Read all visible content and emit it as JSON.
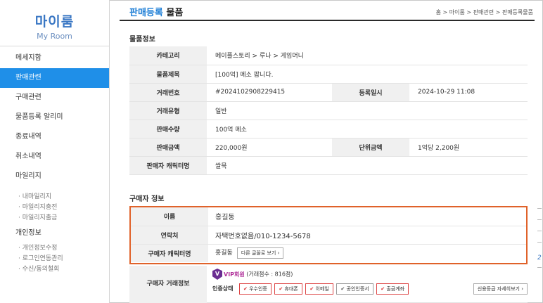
{
  "sidebar": {
    "brand_title": "마이룸",
    "brand_subtitle": "My Room",
    "items": [
      {
        "label": "메세지함"
      },
      {
        "label": "판매관련"
      },
      {
        "label": "구매관련"
      },
      {
        "label": "물품등록 알리미"
      },
      {
        "label": "종료내역"
      },
      {
        "label": "취소내역"
      },
      {
        "label": "마일리지"
      }
    ],
    "mileage_sub": [
      "· 내마일리지",
      "· 마일리지충전",
      "· 마일리지출금"
    ],
    "personal": "개인정보",
    "personal_sub": [
      "· 개인정보수정",
      "· 로그인연동관리",
      "· 수신/동의철회"
    ]
  },
  "header": {
    "title_accent": "판매등록",
    "title_rest": " 물품",
    "breadcrumb": "홈 > 마이룸 > 판매관련 > 판매등록물품"
  },
  "item_info": {
    "section_title": "물품정보",
    "category_label": "카테고리",
    "category_value": "메이플스토리 > 루나 > 게임머니",
    "subject_label": "물품제목",
    "subject_value": "[100억] 메소 팝니다.",
    "trade_no_label": "거래번호",
    "trade_no_value": "#2024102908229415",
    "reg_date_label": "등록일시",
    "reg_date_value": "2024-10-29 11:08",
    "trade_type_label": "거래유형",
    "trade_type_value": "일반",
    "qty_label": "판매수량",
    "qty_value": "100억 메소",
    "amount_label": "판매금액",
    "amount_value": "220,000원",
    "unit_label": "단위금액",
    "unit_value": "1억당 2,200원",
    "seller_char_label": "판매자 캐릭터명",
    "seller_char_value": "쌀묵"
  },
  "buyer_info": {
    "section_title": "구매자 정보",
    "name_label": "이름",
    "name_value": "홍길동",
    "contact_label": "연락처",
    "contact_value": "자택번호없음/010-1234-5678",
    "char_label": "구매자 캐릭터명",
    "char_value": "홍길동",
    "char_button": "다른 글꼴로 보기 ›"
  },
  "buyer_trade": {
    "label": "구매자 거래정보",
    "vip_badge": "V",
    "vip_level": "VIP회원",
    "vip_score": " (거래점수 : 816점)",
    "cert_label": "인증상태",
    "certs": [
      {
        "label": "우수인증",
        "mark": "✔"
      },
      {
        "label": "휴대폰",
        "mark": "✔"
      },
      {
        "label": "이메일",
        "mark": "✔"
      },
      {
        "label": "공인인증서",
        "mark": "✔"
      },
      {
        "label": "출금계좌",
        "mark": "✔"
      }
    ],
    "credit_button": "신용등급 자세히보기 ›"
  },
  "scroll_number": "2",
  "colors": {
    "accent": "#1f8fe8",
    "highlight": "#e0622a",
    "vip": "#6a2c91"
  }
}
